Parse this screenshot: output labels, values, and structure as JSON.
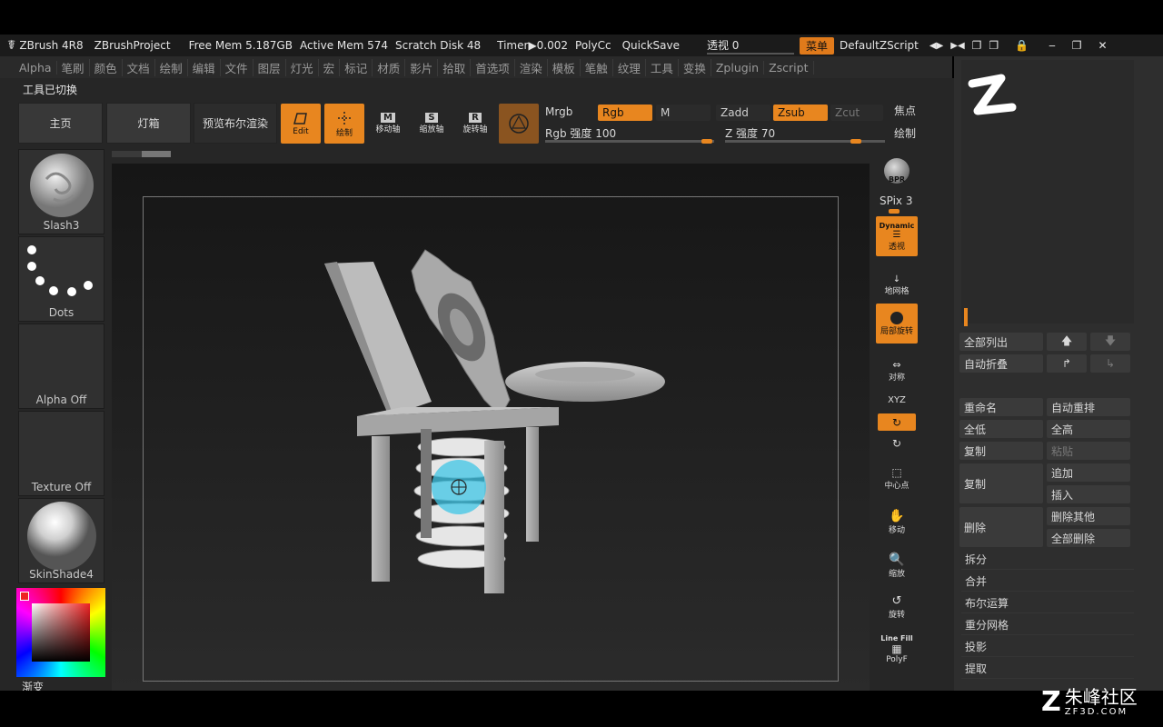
{
  "titlebar": {
    "app": "ZBrush 4R8",
    "project": "ZBrushProject",
    "free_mem": "Free Mem 5.187GB",
    "active_mem": "Active Mem 574",
    "scratch": "Scratch Disk 48",
    "timer": "Timer▶0.002",
    "polyc": "PolyCc",
    "quicksave": "QuickSave",
    "perspective": "透视  0",
    "menu_btn": "菜单",
    "zscript": "DefaultZScript"
  },
  "menubar": [
    "Alpha",
    "笔刷",
    "颜色",
    "文档",
    "绘制",
    "编辑",
    "文件",
    "图层",
    "灯光",
    "宏",
    "标记",
    "材质",
    "影片",
    "拾取",
    "首选项",
    "渲染",
    "模板",
    "笔触",
    "纹理",
    "工具",
    "变换",
    "Zplugin",
    "Zscript"
  ],
  "status": "工具已切换",
  "toolbar": {
    "home": "主页",
    "lightbox": "灯箱",
    "preview_bool": "预览布尔渲染",
    "edit": "Edit",
    "draw": "绘制",
    "move": "移动轴",
    "scale": "缩放轴",
    "rotate": "旋转轴",
    "mrgb": "Mrgb",
    "rgb": "Rgb",
    "m": "M",
    "zadd": "Zadd",
    "zsub": "Zsub",
    "zcut": "Zcut",
    "rgb_intensity": "Rgb 强度 100",
    "z_intensity": "Z 强度 70",
    "focal": "焦点",
    "draw_size": "绘制"
  },
  "left_palette": {
    "brush": "Slash3",
    "stroke": "Dots",
    "alpha": "Alpha Off",
    "texture": "Texture Off",
    "material": "SkinShade4",
    "gradient": "渐变"
  },
  "right_toolbar": {
    "bpr": "BPR",
    "spix": "SPix 3",
    "dynamic": "Dynamic",
    "persp": "透视",
    "floor": "地网格",
    "local": "局部旋转",
    "sym": "对称",
    "xyz": "XYZ",
    "center": "中心点",
    "move": "移动",
    "scale": "缩放",
    "rotate": "旋转",
    "linefill": "Line Fill",
    "polyf": "PolyF"
  },
  "subtool": {
    "list_all": "全部列出",
    "auto_collapse": "自动折叠",
    "rename": "重命名",
    "auto_reorder": "自动重排",
    "all_low": "全低",
    "all_high": "全高",
    "copy": "复制",
    "paste": "粘贴",
    "duplicate": "复制",
    "append": "追加",
    "insert": "插入",
    "delete": "删除",
    "del_other": "删除其他",
    "del_all": "全部删除",
    "split": "拆分",
    "merge": "合并",
    "boolean": "布尔运算",
    "remesh": "重分网格",
    "project": "投影",
    "extract": "提取"
  },
  "watermark": {
    "name": "朱峰社区",
    "url": "ZF3D.COM"
  },
  "colors": {
    "accent": "#e8861f",
    "panel": "#2e2e2e",
    "canvas": "#1f1f1f"
  }
}
